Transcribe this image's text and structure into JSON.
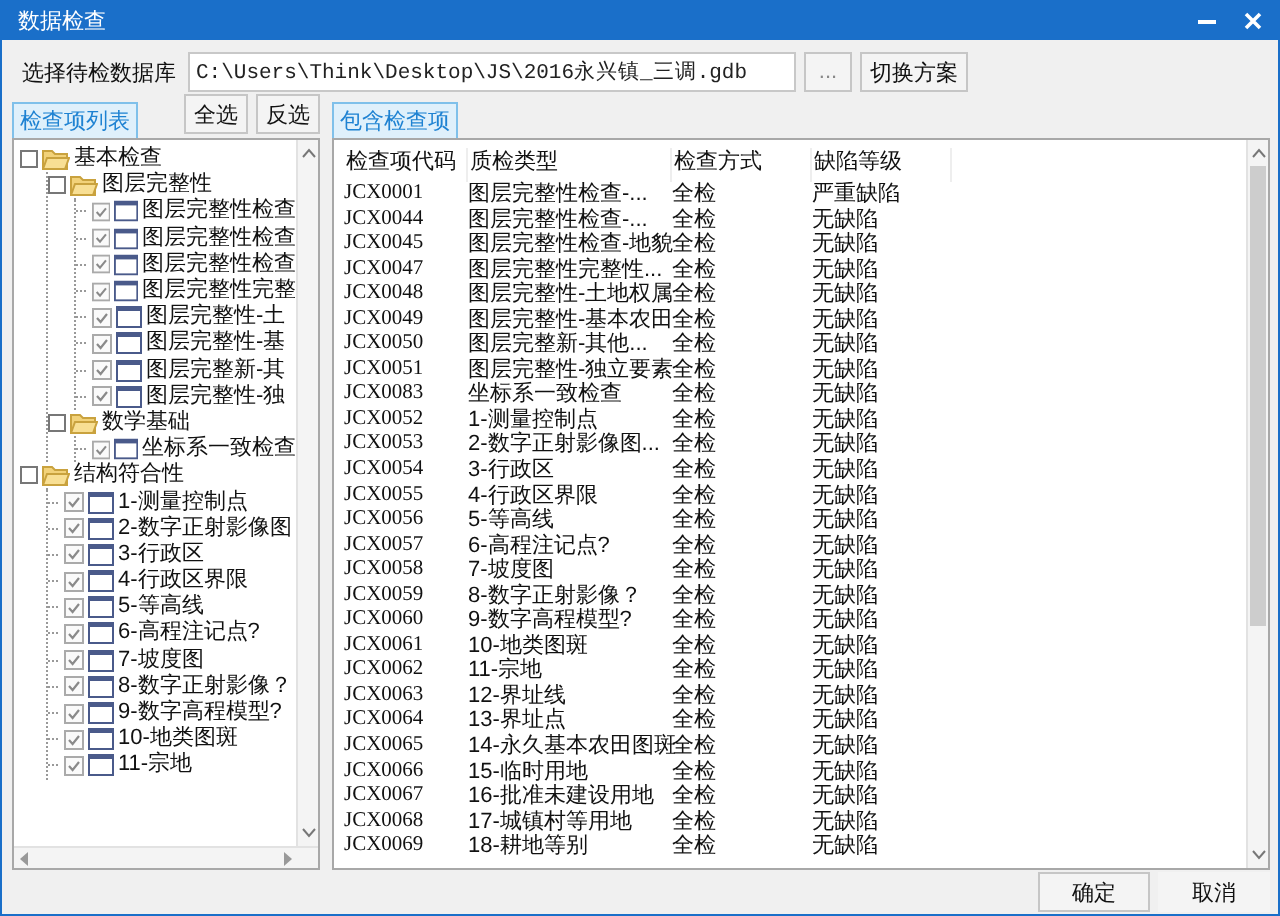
{
  "window": {
    "title": "数据检查"
  },
  "database": {
    "label": "选择待检数据库",
    "path": "C:\\Users\\Think\\Desktop\\JS\\2016永兴镇_三调.gdb",
    "browse_button": "...",
    "switch_button": "切换方案"
  },
  "check_list": {
    "tab": {
      "label": "检查项列表",
      "selected": true
    },
    "buttons": [
      "全选",
      "反选"
    ],
    "tree": [
      {
        "label": "基本检查",
        "kind": "folder",
        "children": [
          {
            "label": "图层完整性",
            "kind": "folder",
            "children": [
              {
                "label": "图层完整性检查",
                "kind": "item",
                "checked": true
              },
              {
                "label": "图层完整性检查",
                "kind": "item",
                "checked": true
              },
              {
                "label": "图层完整性检查",
                "kind": "item",
                "checked": true
              },
              {
                "label": "图层完整性完整",
                "kind": "item",
                "checked": true
              },
              {
                "label": "图层完整性-土",
                "kind": "item",
                "checked": true
              },
              {
                "label": "图层完整性-基",
                "kind": "item",
                "checked": true
              },
              {
                "label": "图层完整新-其",
                "kind": "item",
                "checked": true
              },
              {
                "label": "图层完整性-独",
                "kind": "item",
                "checked": true
              }
            ]
          },
          {
            "label": "数学基础",
            "kind": "folder",
            "children": [
              {
                "label": "坐标系一致检查",
                "kind": "item",
                "checked": true
              }
            ]
          }
        ]
      },
      {
        "label": "结构符合性",
        "kind": "folder",
        "children": [
          {
            "label": "1-测量控制点",
            "kind": "item",
            "checked": true
          },
          {
            "label": "2-数字正射影像图",
            "kind": "item",
            "checked": true
          },
          {
            "label": "3-行政区",
            "kind": "item",
            "checked": true
          },
          {
            "label": "4-行政区界限",
            "kind": "item",
            "checked": true
          },
          {
            "label": "5-等高线",
            "kind": "item",
            "checked": true
          },
          {
            "label": "6-高程注记点?",
            "kind": "item",
            "checked": true
          },
          {
            "label": "7-坡度图",
            "kind": "item",
            "checked": true
          },
          {
            "label": "8-数字正射影像？",
            "kind": "item",
            "checked": true
          },
          {
            "label": "9-数字高程模型?",
            "kind": "item",
            "checked": true
          },
          {
            "label": "10-地类图斑",
            "kind": "item",
            "checked": true
          },
          {
            "label": "11-宗地",
            "kind": "item",
            "checked": true
          }
        ]
      }
    ]
  },
  "included": {
    "tab": {
      "label": "包含检查项",
      "selected": true
    },
    "columns": [
      "检查项代码",
      "质检类型",
      "检查方式",
      "缺陷等级"
    ],
    "rows": [
      {
        "code": "JCX0001",
        "type": "图层完整性检查-...",
        "method": "全检",
        "defect": "严重缺陷"
      },
      {
        "code": "JCX0044",
        "type": "图层完整性检查-...",
        "method": "全检",
        "defect": "无缺陷"
      },
      {
        "code": "JCX0045",
        "type": "图层完整性检查-地貌",
        "method": "全检",
        "defect": "无缺陷"
      },
      {
        "code": "JCX0047",
        "type": "图层完整性完整性...",
        "method": "全检",
        "defect": "无缺陷"
      },
      {
        "code": "JCX0048",
        "type": "图层完整性-土地权属",
        "method": "全检",
        "defect": "无缺陷"
      },
      {
        "code": "JCX0049",
        "type": "图层完整性-基本农田",
        "method": "全检",
        "defect": "无缺陷"
      },
      {
        "code": "JCX0050",
        "type": "图层完整新-其他...",
        "method": "全检",
        "defect": "无缺陷"
      },
      {
        "code": "JCX0051",
        "type": "图层完整性-独立要素",
        "method": "全检",
        "defect": "无缺陷"
      },
      {
        "code": "JCX0083",
        "type": "坐标系一致检查",
        "method": "全检",
        "defect": "无缺陷"
      },
      {
        "code": "JCX0052",
        "type": "1-测量控制点",
        "method": "全检",
        "defect": "无缺陷"
      },
      {
        "code": "JCX0053",
        "type": "2-数字正射影像图...",
        "method": "全检",
        "defect": "无缺陷"
      },
      {
        "code": "JCX0054",
        "type": "3-行政区",
        "method": "全检",
        "defect": "无缺陷"
      },
      {
        "code": "JCX0055",
        "type": "4-行政区界限",
        "method": "全检",
        "defect": "无缺陷"
      },
      {
        "code": "JCX0056",
        "type": "5-等高线",
        "method": "全检",
        "defect": "无缺陷"
      },
      {
        "code": "JCX0057",
        "type": "6-高程注记点?",
        "method": "全检",
        "defect": "无缺陷"
      },
      {
        "code": "JCX0058",
        "type": "7-坡度图",
        "method": "全检",
        "defect": "无缺陷"
      },
      {
        "code": "JCX0059",
        "type": "8-数字正射影像？",
        "method": "全检",
        "defect": "无缺陷"
      },
      {
        "code": "JCX0060",
        "type": "9-数字高程模型?",
        "method": "全检",
        "defect": "无缺陷"
      },
      {
        "code": "JCX0061",
        "type": "10-地类图斑",
        "method": "全检",
        "defect": "无缺陷"
      },
      {
        "code": "JCX0062",
        "type": "11-宗地",
        "method": "全检",
        "defect": "无缺陷"
      },
      {
        "code": "JCX0063",
        "type": "12-界址线",
        "method": "全检",
        "defect": "无缺陷"
      },
      {
        "code": "JCX0064",
        "type": "13-界址点",
        "method": "全检",
        "defect": "无缺陷"
      },
      {
        "code": "JCX0065",
        "type": "14-永久基本农田图斑",
        "method": "全检",
        "defect": "无缺陷"
      },
      {
        "code": "JCX0066",
        "type": "15-临时用地",
        "method": "全检",
        "defect": "无缺陷"
      },
      {
        "code": "JCX0067",
        "type": "16-批准未建设用地",
        "method": "全检",
        "defect": "无缺陷"
      },
      {
        "code": "JCX0068",
        "type": "17-城镇村等用地",
        "method": "全检",
        "defect": "无缺陷"
      },
      {
        "code": "JCX0069",
        "type": "18-耕地等别",
        "method": "全检",
        "defect": "无缺陷"
      }
    ]
  },
  "buttons": [
    "确定",
    "取消"
  ]
}
